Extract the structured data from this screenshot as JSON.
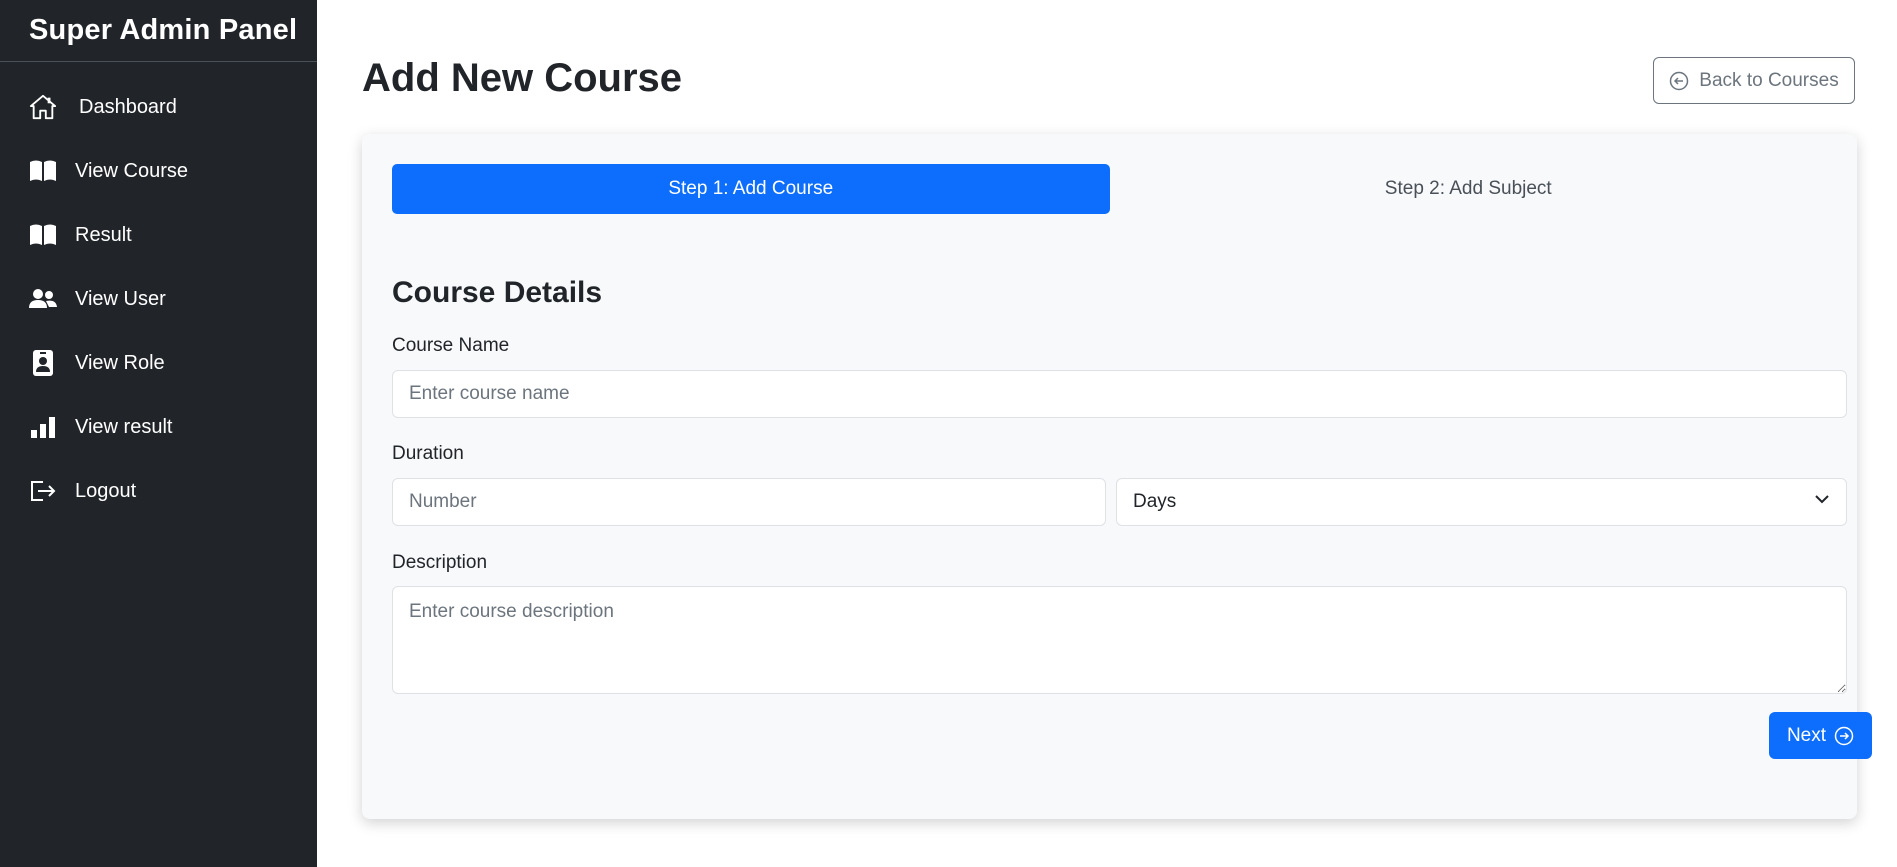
{
  "sidebar": {
    "title": "Super Admin Panel",
    "items": [
      {
        "label": "Dashboard",
        "icon": "home-icon"
      },
      {
        "label": "View Course",
        "icon": "book-icon"
      },
      {
        "label": "Result",
        "icon": "book-icon"
      },
      {
        "label": "View User",
        "icon": "users-icon"
      },
      {
        "label": "View Role",
        "icon": "id-badge-icon"
      },
      {
        "label": "View result",
        "icon": "bar-chart-icon"
      },
      {
        "label": "Logout",
        "icon": "logout-icon"
      }
    ]
  },
  "header": {
    "title": "Add New Course",
    "back_label": "Back to Courses",
    "back_icon": "arrow-left-circle-icon"
  },
  "steps": [
    {
      "label": "Step 1: Add Course",
      "active": true
    },
    {
      "label": "Step 2: Add Subject",
      "active": false
    }
  ],
  "form": {
    "section_title": "Course Details",
    "course_name": {
      "label": "Course Name",
      "placeholder": "Enter course name",
      "value": ""
    },
    "duration": {
      "label": "Duration",
      "number_placeholder": "Number",
      "unit_value": "Days"
    },
    "description": {
      "label": "Description",
      "placeholder": "Enter course description",
      "value": ""
    },
    "next_label": "Next",
    "next_icon": "arrow-right-circle-icon"
  },
  "colors": {
    "sidebar_bg": "#212529",
    "primary": "#0d6efd",
    "card_bg": "#f8f9fa",
    "secondary": "#6c757d"
  }
}
